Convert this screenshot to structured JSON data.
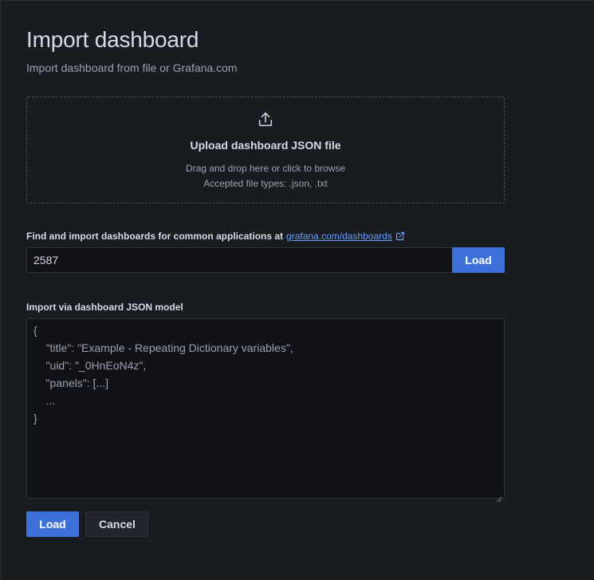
{
  "page": {
    "title": "Import dashboard",
    "subtitle": "Import dashboard from file or Grafana.com"
  },
  "upload": {
    "icon": "upload-icon",
    "title": "Upload dashboard JSON file",
    "hint_line1": "Drag and drop here or click to browse",
    "hint_line2": "Accepted file types: .json, .txt"
  },
  "grafana_com": {
    "label": "Find and import dashboards for common applications at",
    "link_text": "grafana.com/dashboards",
    "link_icon": "external-link-icon",
    "input_value": "2587",
    "load_label": "Load"
  },
  "json_model": {
    "label": "Import via dashboard JSON model",
    "placeholder": "{\n    \"title\": \"Example - Repeating Dictionary variables\",\n    \"uid\": \"_0HnEoN4z\",\n    \"panels\": [...]\n    ...\n}"
  },
  "actions": {
    "load_label": "Load",
    "cancel_label": "Cancel"
  },
  "colors": {
    "background": "#181b1f",
    "input_bg": "#111217",
    "primary": "#3d71d9",
    "link": "#6e9fff",
    "text": "#d8d9e4",
    "muted": "#9ea0ab"
  }
}
